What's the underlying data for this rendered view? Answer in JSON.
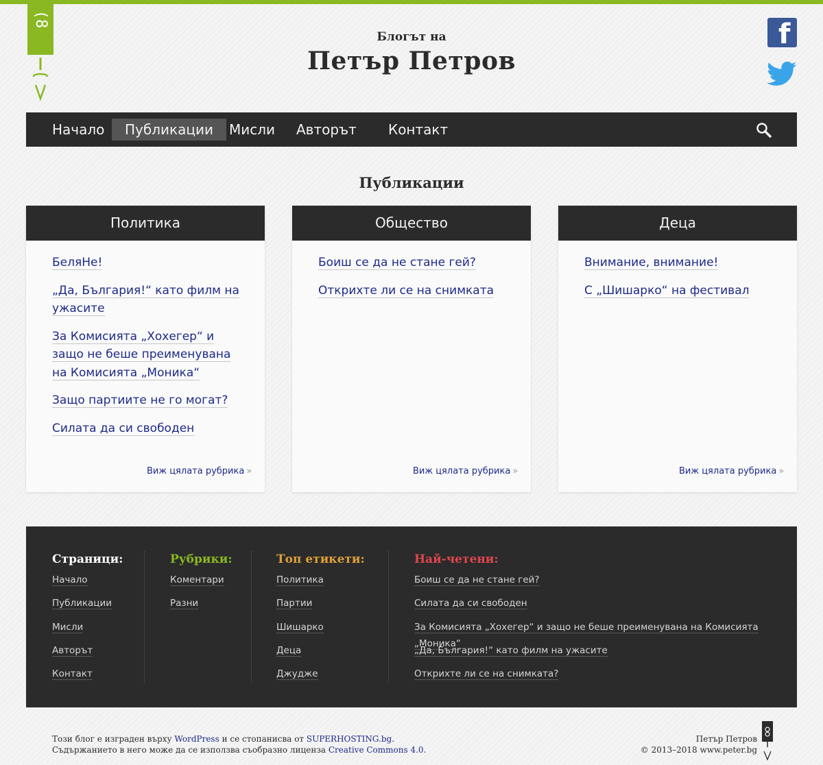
{
  "header": {
    "subtitle": "Блогът на",
    "title": "Петър Петров",
    "logo_glyph": "(8"
  },
  "social": {
    "facebook_icon": "facebook-icon",
    "facebook_letter": "f",
    "twitter_icon": "twitter-icon"
  },
  "nav": {
    "items": [
      {
        "label": "Начало"
      },
      {
        "label": "Публикации"
      },
      {
        "label": "Мисли"
      },
      {
        "label": "Авторът"
      },
      {
        "label": "Контакт"
      }
    ],
    "active": "Публикации",
    "search_icon": "search-icon"
  },
  "page": {
    "title": "Публикации"
  },
  "categories": [
    {
      "name": "Политика",
      "posts": [
        "БеляНе!",
        "„Да, България!“ като филм на ужасите",
        "За Комисията „Хохегер“ и защо не беше преименувана на Комисията „Моника“",
        "Защо партиите не го могат?",
        "Силата да си свободен"
      ],
      "more": "Виж цялата рубрика",
      "more_arrow": "»"
    },
    {
      "name": "Общество",
      "posts": [
        "Боиш се да не стане гей?",
        "Открихте ли се на снимката"
      ],
      "more": "Виж цялата рубрика",
      "more_arrow": "»"
    },
    {
      "name": "Деца",
      "posts": [
        "Внимание, внимание!",
        "С „Шишарко“ на фестивал"
      ],
      "more": "Виж цялата рубрика",
      "more_arrow": "»"
    }
  ],
  "footer": {
    "pages": {
      "title": "Страници:",
      "items": [
        "Начало",
        "Публикации",
        "Мисли",
        "Авторът",
        "Контакт"
      ]
    },
    "rubrics": {
      "title": "Рубрики:",
      "items": [
        "Коментари",
        "Разни"
      ]
    },
    "tags": {
      "title": "Топ етикети:",
      "items": [
        "Политика",
        "Партии",
        "Шишарко",
        "Деца",
        "Джудже"
      ]
    },
    "popular": {
      "title": "Най-четени:",
      "items": [
        "Боиш се да не стане гей?",
        "Силата да си свободен",
        "За Комисията „Хохегер“ и защо не беше преименувана на Комисията „Моника“",
        "„Да, България!“ като филм на ужасите",
        "Открихте ли се на снимката?"
      ]
    },
    "colors": {
      "pages": "#ffffff",
      "rubrics": "#8ab823",
      "tags": "#e0a13a",
      "popular": "#e0474c"
    }
  },
  "bottom": {
    "line1_a": "Този блог е изграден върху ",
    "wordpress": "WordPress",
    "line1_b": " и се стопанисва от ",
    "superhosting": "SUPERHOSTING.bg",
    "line1_c": ".",
    "line2_a": "Съдържанието в него може да се използва съобразно лиценза ",
    "cc": "Creative Commons 4.0",
    "line2_b": ".",
    "author": "Петър Петров",
    "copyright": "© 2013–2018 www.peter.bg"
  }
}
